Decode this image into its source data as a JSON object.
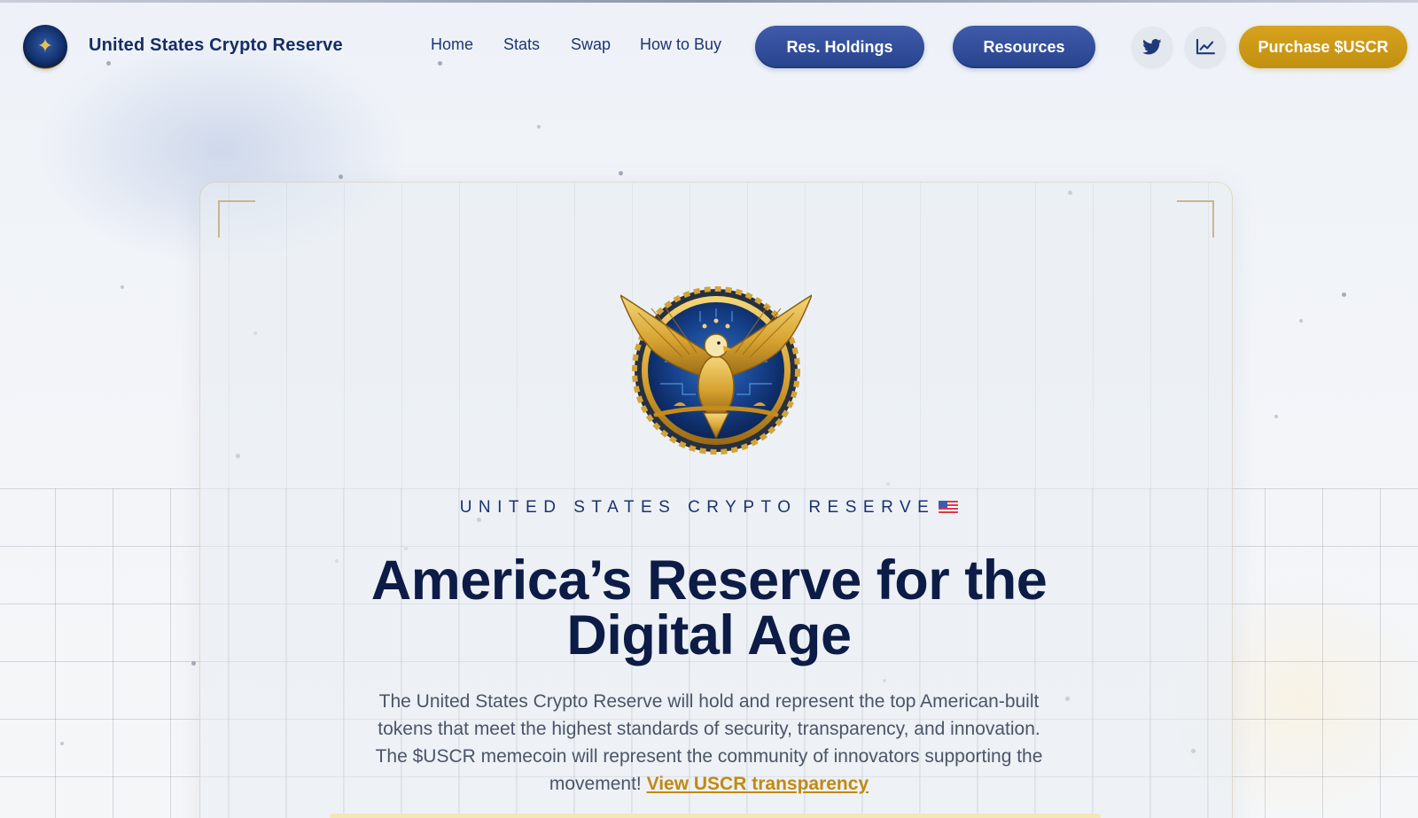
{
  "brand": {
    "name": "United States Crypto Reserve",
    "logo_icon": "eagle-seal-icon"
  },
  "nav": {
    "items": [
      "Home",
      "Stats",
      "Swap",
      "How to Buy"
    ],
    "pills": [
      "Res. Holdings",
      "Resources"
    ],
    "social": [
      {
        "icon": "twitter-icon"
      },
      {
        "icon": "chart-line-icon"
      }
    ],
    "cta": "Purchase $USCR"
  },
  "hero": {
    "emblem_icon": "golden-eagle-emblem-icon",
    "kicker": "UNITED STATES CRYPTO RESERVE",
    "flag_icon": "us-flag-icon",
    "headline_line1": "America’s Reserve for the",
    "headline_line2": "Digital Age",
    "description": "The United States Crypto Reserve will hold and represent the top American-built tokens that meet the highest standards of security, transparency, and innovation. The $USCR memecoin will represent the community of innovators supporting the movement!",
    "link_text": "View USCR transparency"
  },
  "colors": {
    "navy": "#0c1c46",
    "pill_blue": "#2f4b9a",
    "gold": "#c8940f",
    "link_gold": "#c08a12"
  }
}
